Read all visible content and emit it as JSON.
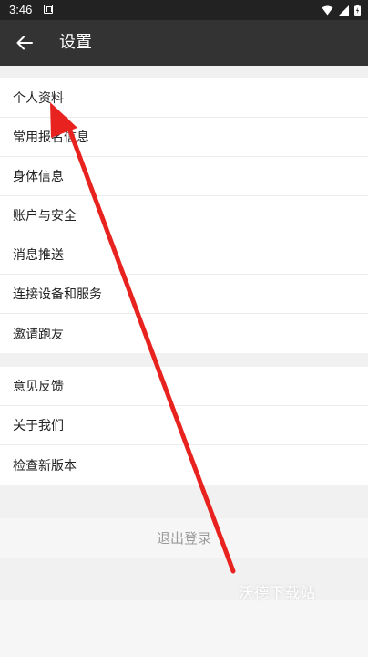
{
  "status_bar": {
    "time": "3:46"
  },
  "toolbar": {
    "title": "设置"
  },
  "groups": [
    {
      "items": [
        "个人资料",
        "常用报名信息",
        "身体信息",
        "账户与安全",
        "消息推送",
        "连接设备和服务",
        "邀请跑友"
      ]
    },
    {
      "items": [
        "意见反馈",
        "关于我们",
        "检查新版本"
      ]
    }
  ],
  "logout": {
    "label": "退出登录"
  },
  "watermark": {
    "text": "沃德下载站"
  },
  "colors": {
    "toolbar": "#333333",
    "status_bar": "#222222",
    "annotation_arrow": "#e8231f"
  }
}
